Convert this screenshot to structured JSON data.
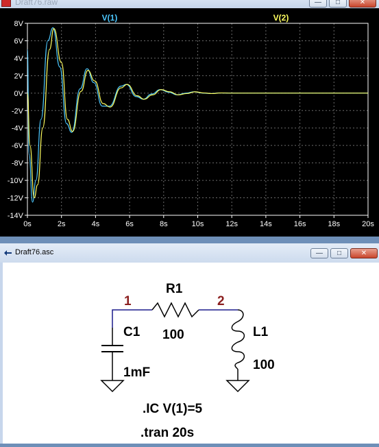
{
  "raw_window": {
    "title": "Draft76.raw",
    "trace_labels": [
      "V(1)",
      "V(2)"
    ],
    "trace_colors": [
      "#4cc8ff",
      "#ffff60"
    ]
  },
  "asc_window": {
    "title": "Draft76.asc",
    "node1": "1",
    "node2": "2",
    "r_name": "R1",
    "r_value": "100",
    "c_name": "C1",
    "c_value": "1mF",
    "l_name": "L1",
    "l_value": "100",
    "ic_directive": ".IC V(1)=5",
    "tran_directive": ".tran 20s"
  },
  "chart_data": {
    "type": "line",
    "title": "",
    "xlabel": "",
    "ylabel": "",
    "xlim": [
      0,
      20
    ],
    "ylim": [
      -14,
      8
    ],
    "x_unit": "s",
    "y_unit": "V",
    "x_ticks": [
      "0s",
      "2s",
      "4s",
      "6s",
      "8s",
      "10s",
      "12s",
      "14s",
      "16s",
      "18s",
      "20s"
    ],
    "y_ticks": [
      "8V",
      "6V",
      "4V",
      "2V",
      "0V",
      "-2V",
      "-4V",
      "-6V",
      "-8V",
      "-10V",
      "-12V",
      "-14V"
    ],
    "grid": true,
    "series": [
      {
        "name": "V(1)",
        "color": "#4cc8ff",
        "x": [
          0,
          0.1,
          0.3,
          0.5,
          0.8,
          1.2,
          1.5,
          1.9,
          2.3,
          2.6,
          3.1,
          3.5,
          3.9,
          4.4,
          4.8,
          5.5,
          5.8,
          6.4,
          6.8,
          7.3,
          7.8,
          8.3,
          8.8,
          9.3,
          9.8,
          10.3,
          10.8,
          11.3,
          12,
          20
        ],
        "y": [
          5,
          -7,
          -12.5,
          -10,
          -3,
          6,
          7.5,
          3,
          -3.5,
          -4.5,
          0.5,
          2.8,
          1.2,
          -1.5,
          -1.5,
          0.8,
          1,
          -0.4,
          -0.7,
          -0.1,
          0.4,
          0.1,
          -0.2,
          0,
          0.15,
          0,
          -0.05,
          0.02,
          0,
          0
        ]
      },
      {
        "name": "V(2)",
        "color": "#ffff60",
        "x": [
          0,
          0.15,
          0.4,
          0.6,
          0.9,
          1.3,
          1.55,
          2.0,
          2.35,
          2.65,
          3.15,
          3.55,
          3.95,
          4.45,
          4.85,
          5.5,
          5.85,
          6.45,
          6.85,
          7.35,
          7.85,
          8.35,
          8.85,
          9.35,
          9.85,
          10.35,
          10.85,
          11.35,
          12,
          20
        ],
        "y": [
          0,
          -6,
          -12,
          -10.5,
          -4,
          5,
          7.4,
          3.5,
          -3,
          -4.4,
          0.2,
          2.6,
          1.4,
          -1.2,
          -1.6,
          0.6,
          1,
          -0.3,
          -0.7,
          -0.2,
          0.4,
          0.15,
          -0.2,
          -0.05,
          0.15,
          0.02,
          -0.05,
          0.02,
          0,
          0
        ]
      }
    ]
  }
}
